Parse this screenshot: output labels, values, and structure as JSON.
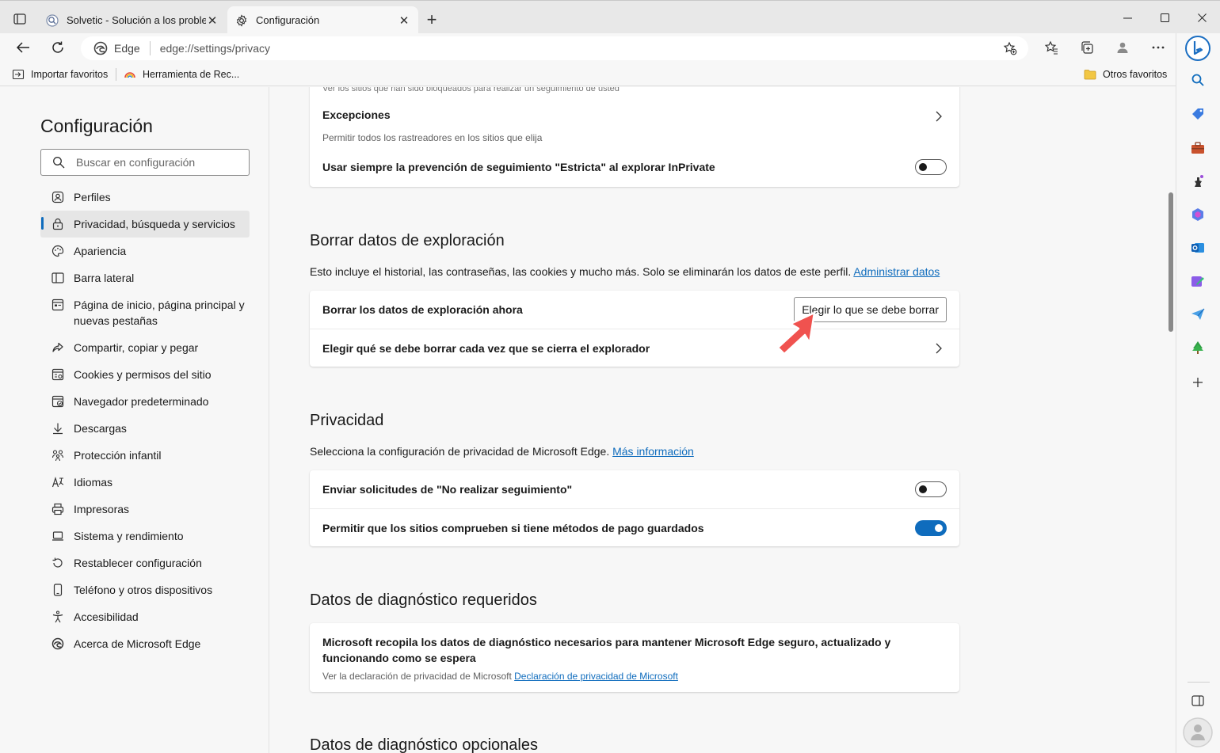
{
  "browser": {
    "tabs": [
      {
        "title": "Solvetic - Solución a los problem",
        "active": false,
        "favicon": "solvetic-favicon-icon"
      },
      {
        "title": "Configuración",
        "active": true,
        "favicon": "gear-icon"
      }
    ],
    "address": {
      "scheme_label": "Edge",
      "url": "edge://settings/privacy"
    },
    "favorites_bar": {
      "items": [
        {
          "label": "Importar favoritos",
          "icon": "import-icon"
        },
        {
          "label": "Herramienta de Rec...",
          "icon": "rainbow-icon"
        }
      ],
      "other_label": "Otros favoritos"
    }
  },
  "settings_nav": {
    "title": "Configuración",
    "search_placeholder": "Buscar en configuración",
    "items": [
      {
        "label": "Perfiles",
        "icon": "profile-icon",
        "selected": false
      },
      {
        "label": "Privacidad, búsqueda y servicios",
        "icon": "lock-icon",
        "selected": true
      },
      {
        "label": "Apariencia",
        "icon": "palette-icon",
        "selected": false
      },
      {
        "label": "Barra lateral",
        "icon": "sidebar-icon",
        "selected": false
      },
      {
        "label": "Página de inicio, página principal y nuevas pestañas",
        "icon": "home-icon",
        "selected": false
      },
      {
        "label": "Compartir, copiar y pegar",
        "icon": "share-icon",
        "selected": false
      },
      {
        "label": "Cookies y permisos del sitio",
        "icon": "cookie-icon",
        "selected": false
      },
      {
        "label": "Navegador predeterminado",
        "icon": "browser-icon",
        "selected": false
      },
      {
        "label": "Descargas",
        "icon": "download-icon",
        "selected": false
      },
      {
        "label": "Protección infantil",
        "icon": "family-icon",
        "selected": false
      },
      {
        "label": "Idiomas",
        "icon": "language-icon",
        "selected": false
      },
      {
        "label": "Impresoras",
        "icon": "printer-icon",
        "selected": false
      },
      {
        "label": "Sistema y rendimiento",
        "icon": "laptop-icon",
        "selected": false
      },
      {
        "label": "Restablecer configuración",
        "icon": "reset-icon",
        "selected": false
      },
      {
        "label": "Teléfono y otros dispositivos",
        "icon": "phone-icon",
        "selected": false
      },
      {
        "label": "Accesibilidad",
        "icon": "accessibility-icon",
        "selected": false
      },
      {
        "label": "Acerca de Microsoft Edge",
        "icon": "edge-logo-icon",
        "selected": false
      }
    ]
  },
  "main": {
    "tracking_card": {
      "cut_text": "Ver los sitios que han sido bloqueados para realizar un seguimiento de usted",
      "exceptions_title": "Excepciones",
      "exceptions_sub": "Permitir todos los rastreadores en los sitios que elija",
      "strict_inprivate": "Usar siempre la prevención de seguimiento \"Estricta\" al explorar InPrivate",
      "strict_inprivate_on": false
    },
    "clear_data": {
      "title": "Borrar datos de exploración",
      "desc": "Esto incluye el historial, las contraseñas, las cookies y mucho más. Solo se eliminarán los datos de este perfil.",
      "desc_link": "Administrar datos",
      "now_title": "Borrar los datos de exploración ahora",
      "now_button": "Elegir lo que se debe borrar",
      "on_close_title": "Elegir qué se debe borrar cada vez que se cierra el explorador"
    },
    "privacy": {
      "title": "Privacidad",
      "desc": "Selecciona la configuración de privacidad de Microsoft Edge.",
      "desc_link": "Más información",
      "dnt_title": "Enviar solicitudes de \"No realizar seguimiento\"",
      "dnt_on": false,
      "payment_title": "Permitir que los sitios comprueben si tiene métodos de pago guardados",
      "payment_on": true
    },
    "diagnostics_required": {
      "title": "Datos de diagnóstico requeridos",
      "body": "Microsoft recopila los datos de diagnóstico necesarios para mantener Microsoft Edge seguro, actualizado y funcionando como se espera",
      "sub": "Ver la declaración de privacidad de Microsoft",
      "sub_link": "Declaración de privacidad de Microsoft"
    },
    "diagnostics_optional": {
      "title": "Datos de diagnóstico opcionales"
    }
  },
  "colors": {
    "accent": "#0f6cbd",
    "annotation_arrow": "#f0524f"
  }
}
